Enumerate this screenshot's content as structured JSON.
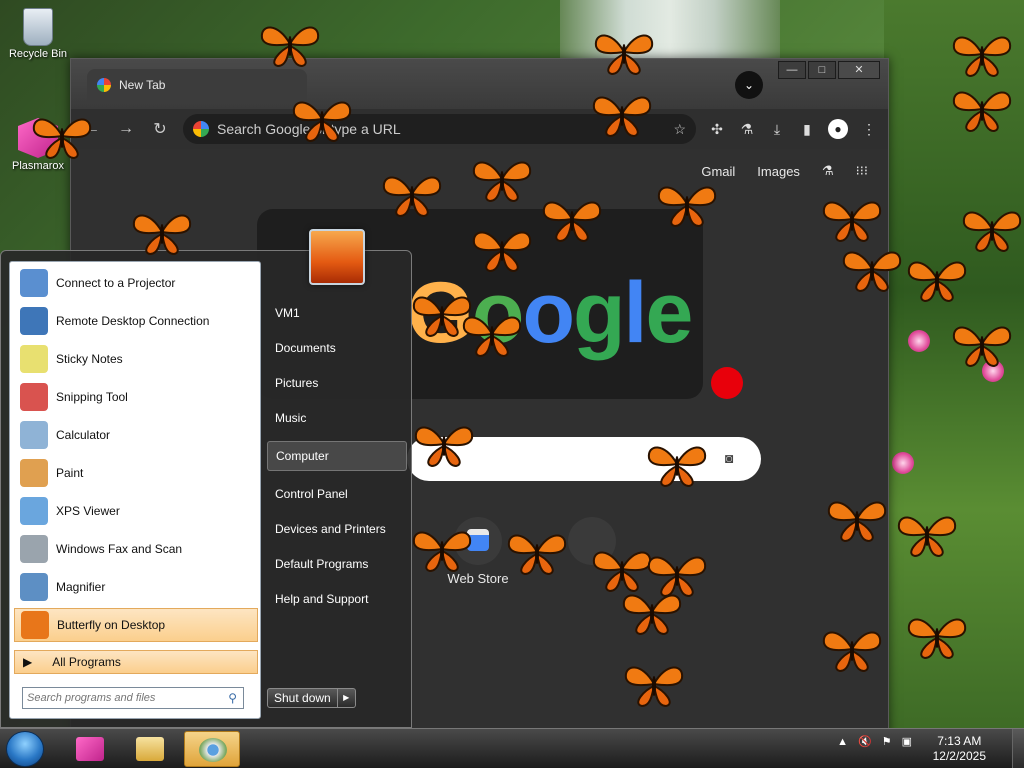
{
  "desktop": {
    "icons": [
      {
        "name": "recycle-bin",
        "label": "Recycle Bin"
      },
      {
        "name": "plasmarox",
        "label": "Plasmarox"
      }
    ]
  },
  "chrome": {
    "tab_title": "New Tab",
    "omnibox_placeholder": "Search Google or type a URL",
    "links": {
      "gmail": "Gmail",
      "images": "Images"
    },
    "shortcut_label": "Web Store"
  },
  "start_menu": {
    "programs": [
      {
        "label": "Connect to a Projector",
        "color": "#5a8fd0"
      },
      {
        "label": "Remote Desktop Connection",
        "color": "#3e76b8"
      },
      {
        "label": "Sticky Notes",
        "color": "#e8e070"
      },
      {
        "label": "Snipping Tool",
        "color": "#d9534f"
      },
      {
        "label": "Calculator",
        "color": "#8fb3d6"
      },
      {
        "label": "Paint",
        "color": "#e0a050"
      },
      {
        "label": "XPS Viewer",
        "color": "#6aa6de"
      },
      {
        "label": "Windows Fax and Scan",
        "color": "#9aa4ad"
      },
      {
        "label": "Magnifier",
        "color": "#5d8fc4"
      },
      {
        "label": "Butterfly on Desktop",
        "color": "#e8761a"
      }
    ],
    "all_programs": "All Programs",
    "search_placeholder": "Search programs and files",
    "right_items": [
      "VM1",
      "Documents",
      "Pictures",
      "Music",
      "Computer",
      "Control Panel",
      "Devices and Printers",
      "Default Programs",
      "Help and Support"
    ],
    "shutdown": "Shut down"
  },
  "taskbar": {
    "time": "7:13 AM",
    "date": "12/2/2025"
  }
}
